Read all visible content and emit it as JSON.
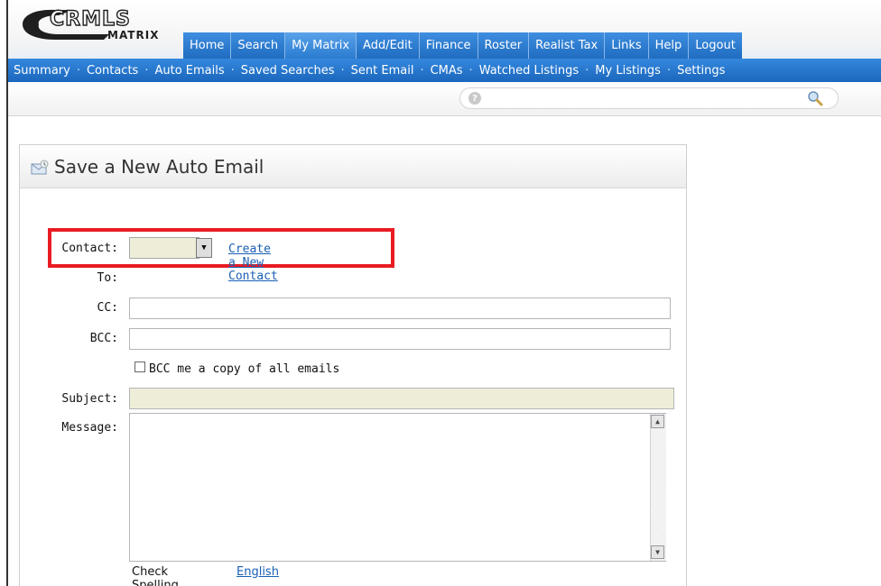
{
  "logo": {
    "text": "CRMLS",
    "sub": "MATRIX"
  },
  "top_nav": [
    "Home",
    "Search",
    "My Matrix",
    "Add/Edit",
    "Finance",
    "Roster",
    "Realist Tax",
    "Links",
    "Help",
    "Logout"
  ],
  "active_top_nav": "My Matrix",
  "sub_nav": [
    "Summary",
    "Contacts",
    "Auto Emails",
    "Saved Searches",
    "Sent Email",
    "CMAs",
    "Watched Listings",
    "My Listings",
    "Settings"
  ],
  "sub_nav_separator": "·",
  "search": {
    "help_icon": "?",
    "placeholder": ""
  },
  "panel": {
    "title": "Save a New Auto Email",
    "icon": "email-icon"
  },
  "form": {
    "contact_label": "Contact:",
    "contact_value": "",
    "create_contact_link": "Create a New Contact",
    "to_label": "To:",
    "cc_label": "CC:",
    "cc_value": "",
    "bcc_label": "BCC:",
    "bcc_value": "",
    "bcc_me_label": "BCC me a copy of all emails",
    "bcc_me_checked": false,
    "subject_label": "Subject:",
    "subject_value": "",
    "message_label": "Message:",
    "message_value": "",
    "check_spelling_label": "Check Spelling",
    "spelling_language": "English"
  },
  "colors": {
    "nav_blue": "#1f6cc0",
    "highlight_red": "#e81b23",
    "required_field_bg": "#eeeed8",
    "link_blue": "#1a5fb4"
  }
}
